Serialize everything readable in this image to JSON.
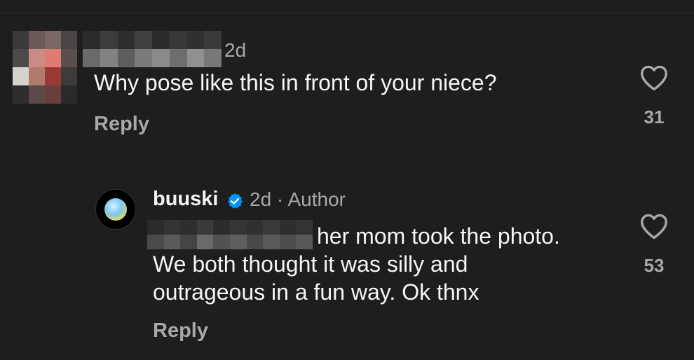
{
  "colors": {
    "background": "#1e1e1e",
    "text_primary": "#f5f5f5",
    "text_secondary": "#a8a8a8",
    "verified_blue": "#0095f6"
  },
  "comments": [
    {
      "username_redacted": true,
      "time": "2d",
      "text": "Why pose like this in front of your niece?",
      "reply_label": "Reply",
      "likes": "31",
      "like_icon": "heart-outline-icon"
    },
    {
      "username": "buuski",
      "verified_icon": "verified-badge-icon",
      "meta": "2d · Author",
      "mention_redacted": true,
      "text_line1": "her mom took the photo.",
      "text_line2": "We both thought it was silly and",
      "text_line3": "outrageous in a fun way. Ok thnx",
      "reply_label": "Reply",
      "likes": "53",
      "like_icon": "heart-outline-icon"
    }
  ]
}
